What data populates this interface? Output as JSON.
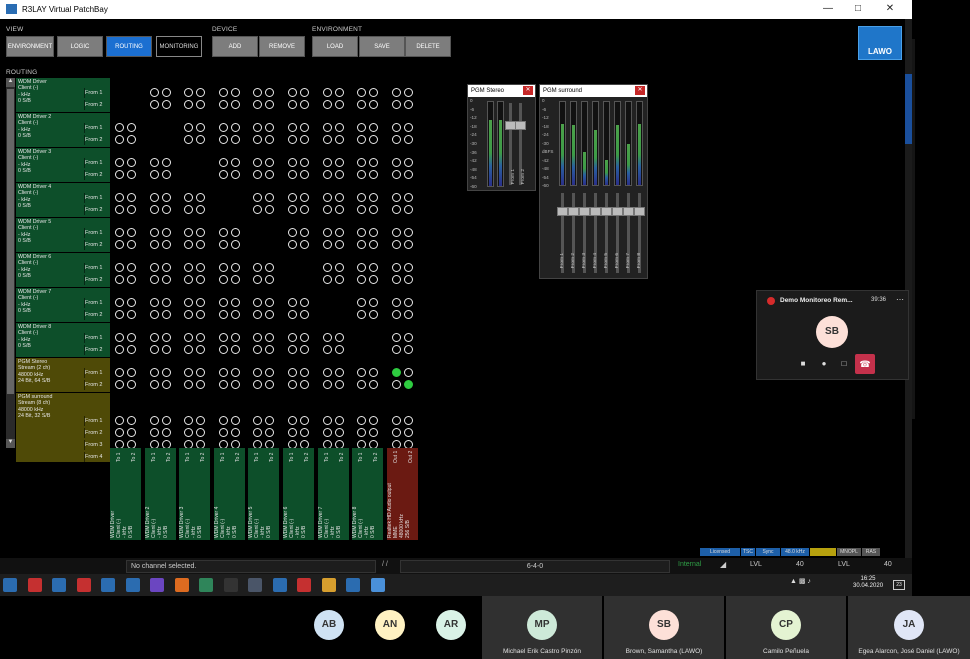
{
  "window": {
    "title": "R3LAY Virtual PatchBay"
  },
  "groups": {
    "view": "VIEW",
    "device": "DEVICE",
    "environment": "ENVIRONMENT",
    "routing": "ROUTING"
  },
  "toolbar": {
    "environment": "ENVIRONMENT",
    "logic": "LOGIC",
    "routing": "ROUTING",
    "monitoring": "MONITORING",
    "add": "ADD",
    "remove": "REMOVE",
    "load": "LOAD",
    "save": "SAVE",
    "delete": "DELETE"
  },
  "logo": "LAWO",
  "sources": [
    {
      "info": "WDM Driver\nClient (-)\n- kHz\n0 S/B",
      "from": [
        "From 1",
        "From 2"
      ],
      "color": "#0d4f2a"
    },
    {
      "info": "WDM Driver 2\nClient (-)\n- kHz\n0 S/B",
      "from": [
        "From 1",
        "From 2"
      ],
      "color": "#0d4f2a"
    },
    {
      "info": "WDM Driver 3\nClient (-)\n- kHz\n0 S/B",
      "from": [
        "From 1",
        "From 2"
      ],
      "color": "#0d4f2a"
    },
    {
      "info": "WDM Driver 4\nClient (-)\n- kHz\n0 S/B",
      "from": [
        "From 1",
        "From 2"
      ],
      "color": "#0d4f2a"
    },
    {
      "info": "WDM Driver 5\nClient (-)\n- kHz\n0 S/B",
      "from": [
        "From 1",
        "From 2"
      ],
      "color": "#0d4f2a"
    },
    {
      "info": "WDM Driver 6\nClient (-)\n- kHz\n0 S/B",
      "from": [
        "From 1",
        "From 2"
      ],
      "color": "#0d4f2a"
    },
    {
      "info": "WDM Driver 7\nClient (-)\n- kHz\n0 S/B",
      "from": [
        "From 1",
        "From 2"
      ],
      "color": "#0d4f2a"
    },
    {
      "info": "WDM Driver 8\nClient (-)\n- kHz\n0 S/B",
      "from": [
        "From 1",
        "From 2"
      ],
      "color": "#0d4f2a"
    },
    {
      "info": "PGM Stereo\nStream (2 ch)\n48000 kHz\n24 Bit, 64 S/B",
      "from": [
        "From 1",
        "From 2"
      ],
      "color": "#4f4a07"
    },
    {
      "info": "PGM surround\nStream (8 ch)\n48000 kHz\n24 Bit, 32 S/B",
      "from": [
        "From 1",
        "From 2",
        "From 3",
        "From 4"
      ],
      "color": "#4f4a07"
    }
  ],
  "destinations": [
    {
      "to": [
        "To 1",
        "To 2"
      ],
      "info": "WDM Driver\nClient (-)\n- kHz\n0 S/B",
      "color": "#0d4f2a"
    },
    {
      "to": [
        "To 1",
        "To 2"
      ],
      "info": "WDM Driver 2\nClient (-)\n- kHz\n0 S/B",
      "color": "#0d4f2a"
    },
    {
      "to": [
        "To 1",
        "To 2"
      ],
      "info": "WDM Driver 3\nClient (-)\n- kHz\n0 S/B",
      "color": "#0d4f2a"
    },
    {
      "to": [
        "To 1",
        "To 2"
      ],
      "info": "WDM Driver 4\nClient (-)\n- kHz\n0 S/B",
      "color": "#0d4f2a"
    },
    {
      "to": [
        "To 1",
        "To 2"
      ],
      "info": "WDM Driver 5\nClient (-)\n- kHz\n0 S/B",
      "color": "#0d4f2a"
    },
    {
      "to": [
        "To 1",
        "To 2"
      ],
      "info": "WDM Driver 6\nClient (-)\n- kHz\n0 S/B",
      "color": "#0d4f2a"
    },
    {
      "to": [
        "To 1",
        "To 2"
      ],
      "info": "WDM Driver 7\nClient (-)\n- kHz\n0 S/B",
      "color": "#0d4f2a"
    },
    {
      "to": [
        "To 1",
        "To 2"
      ],
      "info": "WDM Driver 8\nClient (-)\n- kHz\n0 S/B",
      "color": "#0d4f2a"
    },
    {
      "to": [
        "Out 1",
        "Out 2"
      ],
      "info": "Realtek HD Audio output\nMME\n48000 kHz\n256 S/B",
      "color": "#6b1a12"
    }
  ],
  "matrix_skip_diagonal": true,
  "active_cross": {
    "row": 8,
    "col": 8
  },
  "meters": {
    "stereo": {
      "title": "PGM Stereo",
      "scale": [
        "0",
        "-6",
        "-12",
        "-18",
        "-24",
        "-30",
        "-36",
        "-42",
        "-48",
        "-54",
        "-60"
      ],
      "levels": [
        0.78,
        0.78
      ],
      "labels": [
        "From 1",
        "From 2"
      ]
    },
    "surround": {
      "title": "PGM surround",
      "scale": [
        "0",
        "-6",
        "-12",
        "-18",
        "-24",
        "-30",
        "dBFS",
        "-42",
        "-48",
        "-54",
        "-60"
      ],
      "levels": [
        0.74,
        0.72,
        0.4,
        0.66,
        0.3,
        0.72,
        0.5,
        0.74
      ],
      "labels": [
        "From 1",
        "From 2",
        "From 3",
        "From 4",
        "From 5",
        "From 6",
        "From 7",
        "From 8"
      ]
    }
  },
  "status": {
    "message": "No channel selected.",
    "slash": "/ /",
    "counter": "6-4-0",
    "internal": "Internal",
    "lvl1": "LVL",
    "lvl1v": "40",
    "lvl2": "LVL",
    "lvl2v": "40",
    "badges": [
      "Licensed",
      "TSC",
      "Sync",
      "48.0 kHz",
      "",
      "MNOPL",
      "RAS"
    ]
  },
  "tray": {
    "time": "16:25",
    "date": "30.04.2020",
    "notif": "23"
  },
  "call": {
    "title": "Demo Monitoreo Rem...",
    "time": "39:36",
    "initials": "SB"
  },
  "participants": [
    {
      "initials": "AB",
      "name": "",
      "color": "#cfe2f3"
    },
    {
      "initials": "AN",
      "name": "",
      "color": "#fff2c2"
    },
    {
      "initials": "AR",
      "name": "",
      "color": "#d9f2e6"
    },
    {
      "initials": "MP",
      "name": "Michael Erik Castro Pinzón",
      "color": "#cde9d8"
    },
    {
      "initials": "SB",
      "name": "Brown, Samantha (LAWO)",
      "color": "#fde0d8"
    },
    {
      "initials": "CP",
      "name": "Camilo Peñuela",
      "color": "#e4f3d2"
    },
    {
      "initials": "JA",
      "name": "Egea Alarcon, José Daniel (LAWO)",
      "color": "#e0e6f6"
    }
  ]
}
